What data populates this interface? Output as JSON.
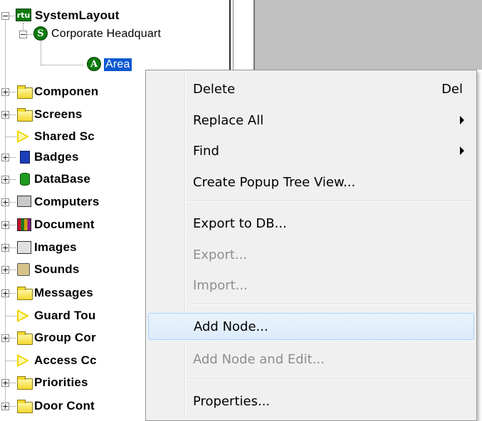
{
  "tree": {
    "root": {
      "label": "SystemLayout",
      "icon": "rtu-icon",
      "icon_text": "rtu"
    },
    "site": {
      "label": "Corporate Headquart",
      "icon_text": "S"
    },
    "area": {
      "label": "Area",
      "icon_text": "A"
    },
    "items": [
      {
        "label": "Componen",
        "icon": "folder-icon",
        "expandable": true
      },
      {
        "label": "Screens",
        "icon": "folder-icon",
        "expandable": true
      },
      {
        "label": "Shared Sc",
        "icon": "arrow-icon",
        "expandable": false
      },
      {
        "label": "Badges",
        "icon": "badge-icon",
        "expandable": true
      },
      {
        "label": "DataBase",
        "icon": "database-icon",
        "expandable": true
      },
      {
        "label": "Computers",
        "icon": "computer-icon",
        "expandable": true
      },
      {
        "label": "Document",
        "icon": "document-icon",
        "expandable": true
      },
      {
        "label": "Images",
        "icon": "images-icon",
        "expandable": true
      },
      {
        "label": "Sounds",
        "icon": "sound-icon",
        "expandable": true
      },
      {
        "label": "Messages",
        "icon": "folder-icon",
        "expandable": true
      },
      {
        "label": "Guard Tou",
        "icon": "arrow-icon",
        "expandable": false
      },
      {
        "label": "Group Cor",
        "icon": "folder-icon",
        "expandable": true
      },
      {
        "label": "Access Cc",
        "icon": "arrow-icon",
        "expandable": false
      },
      {
        "label": "Priorities",
        "icon": "folder-icon",
        "expandable": true
      },
      {
        "label": "Door Cont",
        "icon": "folder-icon",
        "expandable": true
      }
    ]
  },
  "context_menu": {
    "items": [
      {
        "label": "Delete",
        "shortcut": "Del",
        "submenu": false,
        "disabled": false
      },
      {
        "label": "Replace All",
        "shortcut": "",
        "submenu": true,
        "disabled": false
      },
      {
        "label": "Find",
        "shortcut": "",
        "submenu": true,
        "disabled": false
      },
      {
        "label": "Create Popup Tree View...",
        "shortcut": "",
        "submenu": false,
        "disabled": false
      },
      {
        "label": "Export to DB...",
        "shortcut": "",
        "submenu": false,
        "disabled": false
      },
      {
        "label": "Export...",
        "shortcut": "",
        "submenu": false,
        "disabled": true
      },
      {
        "label": "Import...",
        "shortcut": "",
        "submenu": false,
        "disabled": true
      },
      {
        "label": "Add Node...",
        "shortcut": "",
        "submenu": false,
        "disabled": false,
        "highlighted": true
      },
      {
        "label": "Add Node and Edit...",
        "shortcut": "",
        "submenu": false,
        "disabled": true
      },
      {
        "label": "Properties...",
        "shortcut": "",
        "submenu": false,
        "disabled": false
      }
    ]
  },
  "colors": {
    "selection": "#0a58d1",
    "menu_bg": "#f0f0f0",
    "folder": "#f3d92e"
  }
}
